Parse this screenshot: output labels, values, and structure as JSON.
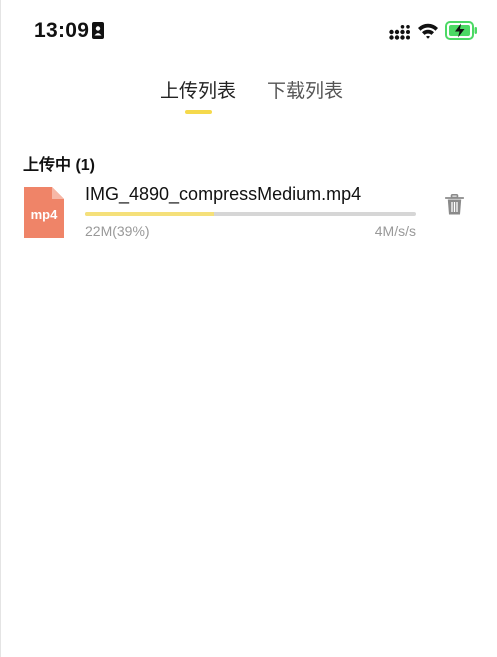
{
  "status_bar": {
    "time": "13:09",
    "id_icon": "id-card-icon",
    "signal_icon": "cellular-signal-icon",
    "wifi_icon": "wifi-icon",
    "battery_icon": "battery-charging-icon",
    "battery_color": "#4cd964"
  },
  "tabs": [
    {
      "label": "上传列表",
      "active": true
    },
    {
      "label": "下载列表",
      "active": false
    }
  ],
  "accent_color": "#f5d94c",
  "section": {
    "title": "上传中 (1)"
  },
  "uploads": [
    {
      "file_type": "mp4",
      "file_icon_color": "#ef8468",
      "file_name": "IMG_4890_compressMedium.mp4",
      "size_text": "22M(39%)",
      "speed_text": "4M/s/s",
      "progress": 0.39,
      "delete_icon": "trash-icon"
    }
  ]
}
